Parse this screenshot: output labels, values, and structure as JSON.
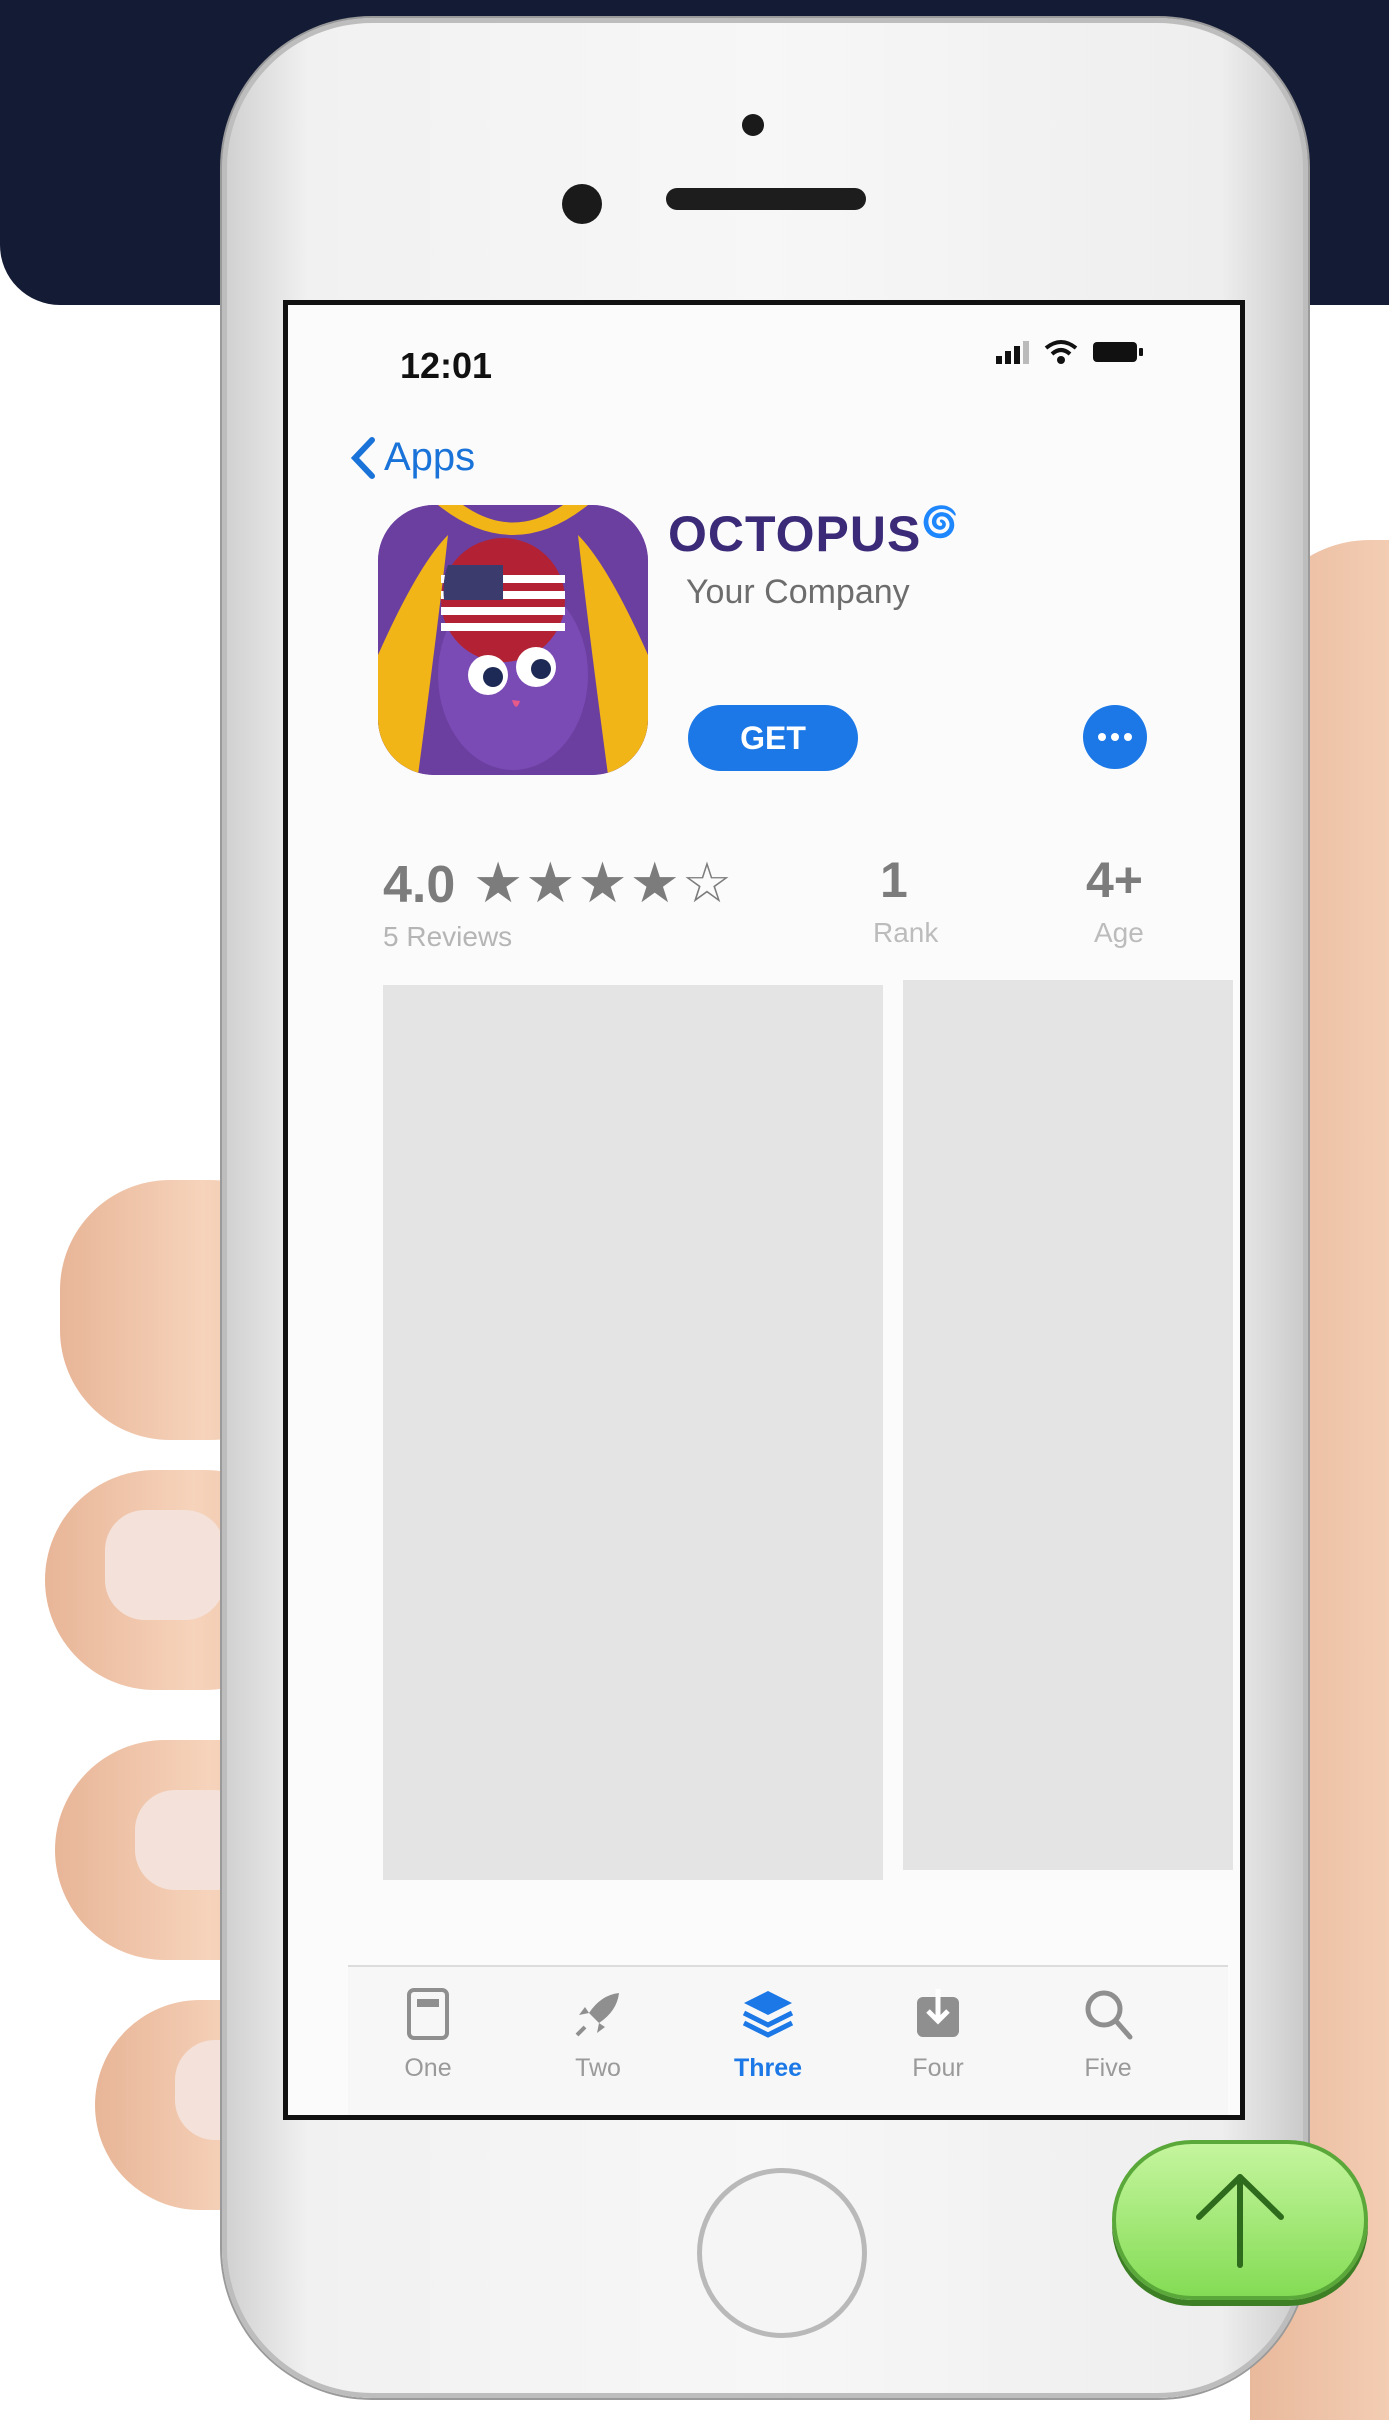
{
  "status_bar": {
    "time": "12:01"
  },
  "nav": {
    "back_label": "Apps"
  },
  "app": {
    "title": "OCTOPUS",
    "developer": "Your Company",
    "get_label": "GET",
    "icon_name": "octopus-app-icon"
  },
  "stats": {
    "rating": "4.0",
    "stars_filled": 4,
    "stars_total": 5,
    "stars_text": "★★★★☆",
    "reviews": "5 Reviews",
    "rank_value": "1",
    "rank_label": "Rank",
    "age_value": "4+",
    "age_label": "Age"
  },
  "tabbar": {
    "tabs": [
      {
        "label": "One",
        "icon": "document-icon"
      },
      {
        "label": "Two",
        "icon": "rocket-icon"
      },
      {
        "label": "Three",
        "icon": "layers-icon",
        "active": true
      },
      {
        "label": "Four",
        "icon": "download-icon"
      },
      {
        "label": "Five",
        "icon": "search-icon"
      }
    ]
  },
  "colors": {
    "accent": "#1b78e6",
    "navy": "#141b34",
    "scroll_button": "#84dc55"
  }
}
